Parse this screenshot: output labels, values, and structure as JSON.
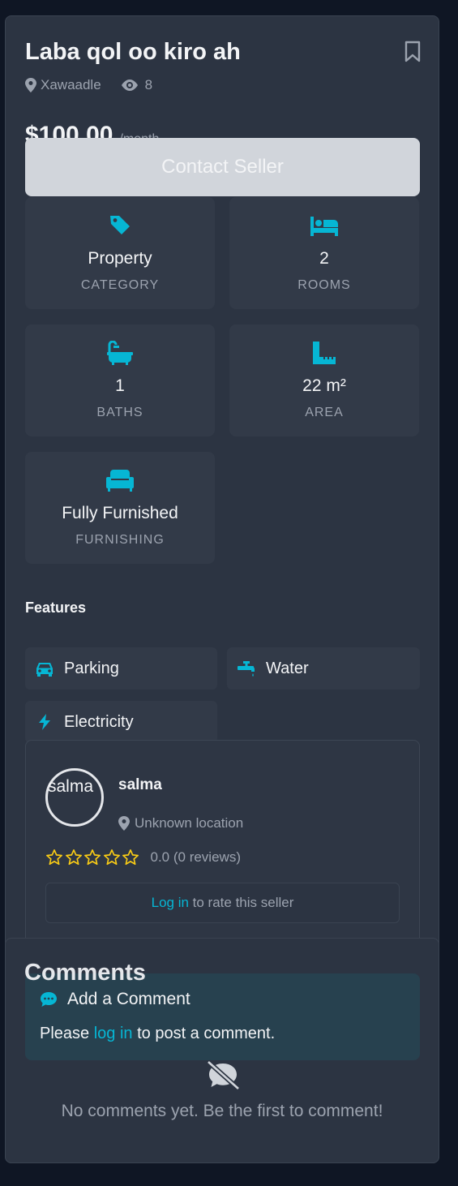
{
  "listing": {
    "title": "Laba qol oo kiro ah",
    "location": "Xawaadle",
    "views": "8",
    "price": "$100.00",
    "price_period": "/month",
    "contact_label": "Contact Seller"
  },
  "details": [
    {
      "icon": "tag-icon",
      "value": "Property",
      "label": "CATEGORY"
    },
    {
      "icon": "bed-icon",
      "value": "2",
      "label": "ROOMS"
    },
    {
      "icon": "bath-icon",
      "value": "1",
      "label": "BATHS"
    },
    {
      "icon": "ruler-icon",
      "value": "22 m²",
      "label": "AREA"
    },
    {
      "icon": "couch-icon",
      "value": "Fully Furnished",
      "label": "FURNISHING"
    }
  ],
  "features": {
    "heading": "Features",
    "items": [
      {
        "icon": "car-icon",
        "label": "Parking"
      },
      {
        "icon": "faucet-icon",
        "label": "Water"
      },
      {
        "icon": "bolt-icon",
        "label": "Electricity"
      }
    ]
  },
  "seller": {
    "avatar_alt": "salma",
    "name": "salma",
    "location": "Unknown location",
    "rating_text": "0.0 (0 reviews)",
    "stars": 0,
    "login_link": "Log in",
    "login_suffix": " to rate this seller"
  },
  "comments": {
    "heading": "Comments",
    "add_title": "Add a Comment",
    "prompt_prefix": "Please ",
    "prompt_link": "log in",
    "prompt_suffix": " to post a comment.",
    "empty_text": "No comments yet. Be the first to comment!"
  },
  "colors": {
    "accent": "#06b6d4",
    "star": "#facc15",
    "background": "#0f1624",
    "card": "#2c3442"
  }
}
